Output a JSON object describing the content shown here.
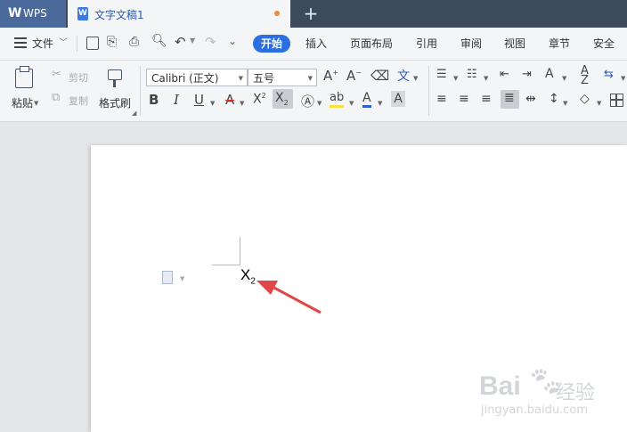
{
  "title_bar": {
    "app_tab": "WPS",
    "doc_tab": "文字文稿1",
    "new_tab": "+"
  },
  "menu": {
    "file": "文件",
    "items": [
      "开始",
      "插入",
      "页面布局",
      "引用",
      "审阅",
      "视图",
      "章节",
      "安全"
    ]
  },
  "ribbon": {
    "paste": "粘贴",
    "cut": "剪切",
    "copy": "复制",
    "format_painter": "格式刷",
    "font_name": "Calibri (正文)",
    "font_size": "五号"
  },
  "document": {
    "text_main": "X",
    "text_sub": "2"
  },
  "watermark": {
    "brand": "Bai",
    "brand2": "经验",
    "url": "jingyan.baidu.com"
  },
  "colors": {
    "accent": "#2c6fe0",
    "title_bar": "#3d4a5c",
    "arrow": "#e04848"
  }
}
